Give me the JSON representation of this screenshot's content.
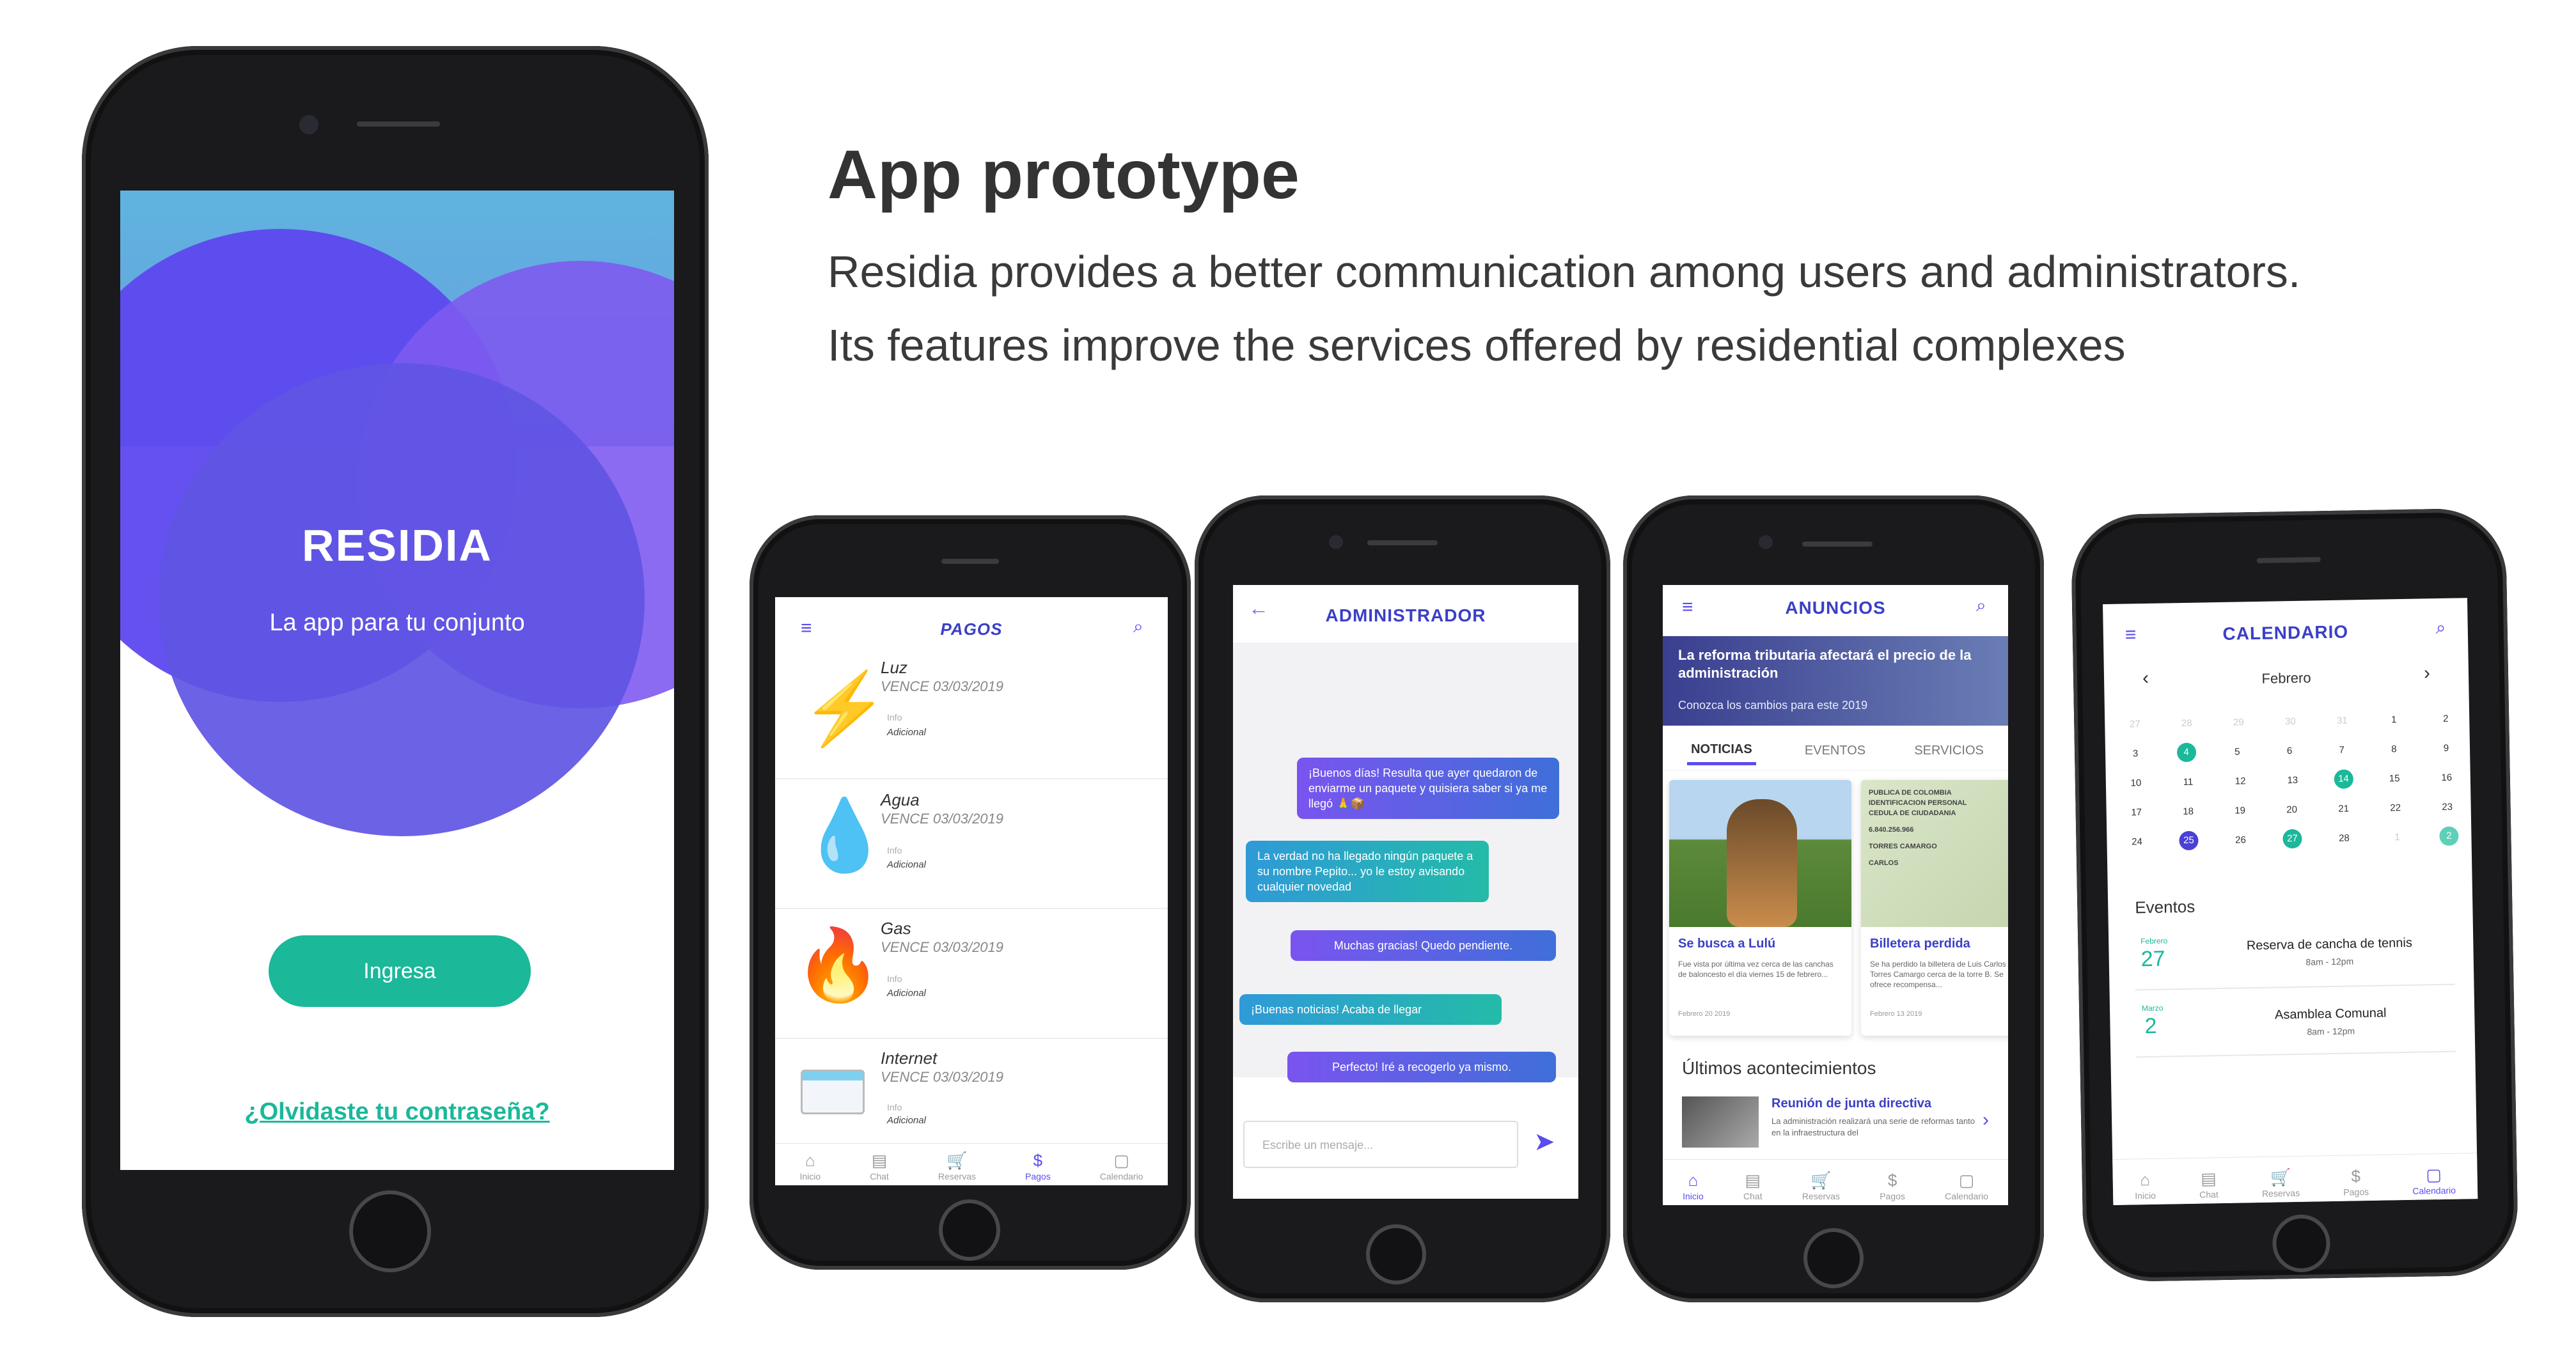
{
  "heading": {
    "title": "App prototype",
    "line1": "Residia provides a better communication among users and administrators.",
    "line2": "Its features improve the services offered by residential complexes"
  },
  "colors": {
    "accent": "#5a4cf0",
    "teal": "#1bb89a",
    "title": "#3b3fc6"
  },
  "login": {
    "brand": "RESIDIA",
    "tagline": "La app para tu conjunto",
    "login_button": "Ingresa",
    "forgot_link": "¿Olvidaste tu contraseña?"
  },
  "tabs": {
    "home": "Inicio",
    "chat": "Chat",
    "bookings": "Reservas",
    "payments": "Pagos",
    "calendar": "Calendario"
  },
  "payments": {
    "title": "PAGOS",
    "items": [
      {
        "name": "Luz",
        "due": "VENCE 03/03/2019",
        "info": "Info",
        "extra": "Adicional",
        "icon": "lightning-icon"
      },
      {
        "name": "Agua",
        "due": "VENCE 03/03/2019",
        "info": "Info",
        "extra": "Adicional",
        "icon": "water-drop-icon"
      },
      {
        "name": "Gas",
        "due": "VENCE 03/03/2019",
        "info": "Info",
        "extra": "Adicional",
        "icon": "fire-icon"
      },
      {
        "name": "Internet",
        "due": "VENCE 03/03/2019",
        "info": "Info",
        "extra": "Adicional",
        "icon": "browser-icon"
      }
    ]
  },
  "chat": {
    "title": "ADMINISTRADOR",
    "messages": [
      "¡Buenos días! Resulta que ayer quedaron de enviarme un paquete y quisiera saber si ya me llegó 🙏📦",
      "La verdad no ha llegado ningún paquete a su nombre Pepito... yo le estoy avisando cualquier novedad",
      "Muchas gracias! Quedo pendiente.",
      "¡Buenas noticias! Acaba de llegar",
      "Perfecto! Iré a recogerlo ya mismo."
    ],
    "input_placeholder": "Escribe un mensaje..."
  },
  "news": {
    "title": "ANUNCIOS",
    "banner_title": "La reforma tributaria afectará el precio de la administración",
    "banner_sub": "Conozca los cambios para este 2019",
    "tabs": [
      "NOTICIAS",
      "EVENTOS",
      "SERVICIOS"
    ],
    "card1_title": "Se busca a Lulú",
    "card1_text": "Fue vista por última vez cerca de las canchas de baloncesto el día viernes 15 de febrero...",
    "card1_date": "Febrero 20 2019",
    "card2_title": "Billetera perdida",
    "card2_text": "Se ha perdido la billetera de Luis Carlos Torres Camargo cerca de la torre B. Se ofrece recompensa...",
    "card2_date": "Febrero 13 2019",
    "id_line1": "PUBLICA DE COLOMBIA",
    "id_line2": "IDENTIFICACION PERSONAL",
    "id_line3": "CEDULA DE CIUDADANIA",
    "id_number": "6.840.256.966",
    "id_surname": "TORRES CAMARGO",
    "id_name": "CARLOS",
    "latest_heading": "Últimos acontecimientos",
    "latest_title": "Reunión de junta directiva",
    "latest_text": "La administración realizará una serie de reformas tanto en la infraestructura del"
  },
  "calendar": {
    "title": "CALENDARIO",
    "month": "Febrero",
    "weeks": [
      [
        "27",
        "28",
        "29",
        "30",
        "31",
        "1",
        "2"
      ],
      [
        "3",
        "4",
        "5",
        "6",
        "7",
        "8",
        "9"
      ],
      [
        "10",
        "11",
        "12",
        "13",
        "14",
        "15",
        "16"
      ],
      [
        "17",
        "18",
        "19",
        "20",
        "21",
        "22",
        "23"
      ],
      [
        "24",
        "25",
        "26",
        "27",
        "28",
        "1",
        "2"
      ]
    ],
    "events_heading": "Eventos",
    "events": [
      {
        "month": "Febrero",
        "day": "27",
        "title": "Reserva de cancha de tennis",
        "time": "8am - 12pm"
      },
      {
        "month": "Marzo",
        "day": "2",
        "title": "Asamblea Comunal",
        "time": "8am - 12pm"
      }
    ]
  }
}
